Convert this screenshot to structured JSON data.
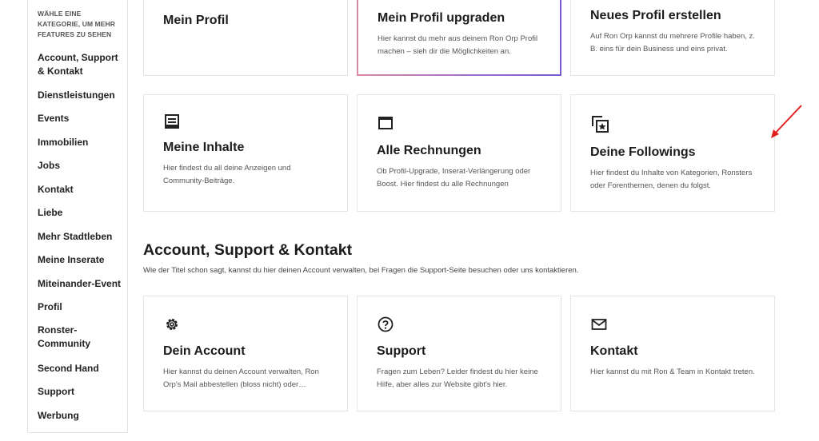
{
  "sidebar": {
    "heading": "WÄHLE EINE KATEGORIE, UM MEHR FEATURES ZU SEHEN",
    "items": [
      {
        "label": "Account, Support & Kontakt"
      },
      {
        "label": "Dienstleistungen"
      },
      {
        "label": "Events"
      },
      {
        "label": "Immobilien"
      },
      {
        "label": "Jobs"
      },
      {
        "label": "Kontakt"
      },
      {
        "label": "Liebe"
      },
      {
        "label": "Mehr Stadtleben"
      },
      {
        "label": "Meine Inserate"
      },
      {
        "label": "Miteinander-Event"
      },
      {
        "label": "Profil"
      },
      {
        "label": "Ronster-Community"
      },
      {
        "label": "Second Hand"
      },
      {
        "label": "Support"
      },
      {
        "label": "Werbung"
      }
    ]
  },
  "top_cards": [
    {
      "title": "Mein Profil",
      "desc": ""
    },
    {
      "title": "Mein Profil upgraden",
      "desc": "Hier kannst du mehr aus deinem Ron Orp Profil machen – sieh dir die Möglichkeiten an."
    },
    {
      "title": "Neues Profil erstellen",
      "desc": "Auf Ron Orp kannst du mehrere Profile haben, z. B. eins für dein Business und eins privat."
    }
  ],
  "middle_cards": [
    {
      "title": "Meine Inhalte",
      "desc": "Hier findest du all deine Anzeigen und Community-Beiträge.",
      "icon": "list-icon"
    },
    {
      "title": "Alle Rechnungen",
      "desc": "Ob Profil-Upgrade, Inserat-Verlängerung oder Boost. Hier findest du alle Rechnungen",
      "icon": "window-icon"
    },
    {
      "title": "Deine Followings",
      "desc": "Hier findest du Inhalte von Kategorien, Ronsters oder Forenthemen, denen du folgst.",
      "icon": "star-copy-icon"
    }
  ],
  "section": {
    "title": "Account, Support & Kontakt",
    "desc": "Wie der Titel schon sagt, kannst du hier deinen Account verwalten, bei Fragen die Support-Seite besuchen oder uns kontaktieren."
  },
  "bottom_cards": [
    {
      "title": "Dein Account",
      "desc": "Hier kannst du deinen Account verwalten, Ron Orp's Mail abbestellen (bloss nicht) oder…",
      "icon": "gear-icon"
    },
    {
      "title": "Support",
      "desc": "Fragen zum Leben? Leider findest du hier keine Hilfe, aber alles zur Website gibt's hier.",
      "icon": "question-icon"
    },
    {
      "title": "Kontakt",
      "desc": "Hier kannst du mit Ron & Team in Kontakt treten.",
      "icon": "mail-icon"
    }
  ],
  "colors": {
    "arrow": "#e02020",
    "highlight_gradient_start": "#d98aa6",
    "highlight_gradient_end": "#7c5ad0"
  }
}
